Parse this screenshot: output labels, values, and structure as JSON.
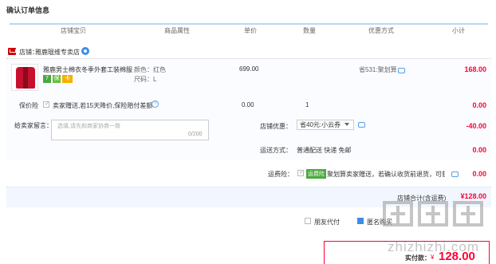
{
  "page": {
    "title": "确认订单信息"
  },
  "table_headers": [
    "店铺宝贝",
    "商品属性",
    "单价",
    "数量",
    "优惠方式",
    "小计"
  ],
  "shop": {
    "label": "店铺：",
    "name": "雅鹿琨维专卖店",
    "chat_icon": "aliwangwang-icon"
  },
  "item": {
    "title": "雅鹿男士棉衣冬季外套工装棉服...",
    "badges": [
      "7",
      "保",
      "卡"
    ],
    "attr_color": "颜色：红色",
    "attr_size": "尺码：L",
    "price": "699.00",
    "promo": "省531:聚划算",
    "subtotal": "168.00"
  },
  "insurance": {
    "label": "保价险",
    "desc": "卖家赠送,若15天降价,保险赔付差额",
    "price": "0.00",
    "qty": "1",
    "subtotal": "0.00"
  },
  "message": {
    "label": "给卖家留言：",
    "placeholder": "选填,请先和商家协商一致",
    "count": "0/200"
  },
  "shop_discount": {
    "label": "店铺优惠：",
    "selected": "省40元:小云券",
    "value": "-40.00"
  },
  "shipping": {
    "label": "运送方式：",
    "text": "普通配送 快递 免邮",
    "value": "0.00"
  },
  "shipping_insurance": {
    "label": "运费险：",
    "tag": "运费险",
    "desc": "聚划算卖家赠送，若确认收货前退货，可获...",
    "value": "0.00"
  },
  "shop_total": {
    "label": "店铺合计(含运费)",
    "value": "¥128.00"
  },
  "options": {
    "anonymous_pay": "朋友代付",
    "anonymous_buy": "匿名购买"
  },
  "payment": {
    "label": "实付款：",
    "currency": "¥",
    "value": "128.00"
  },
  "watermark": {
    "url": "zhizhizhi.com"
  },
  "colors": {
    "accent_red": "#ff0036",
    "header_line": "#b9d7f2",
    "link_blue": "#3a8ee6"
  }
}
